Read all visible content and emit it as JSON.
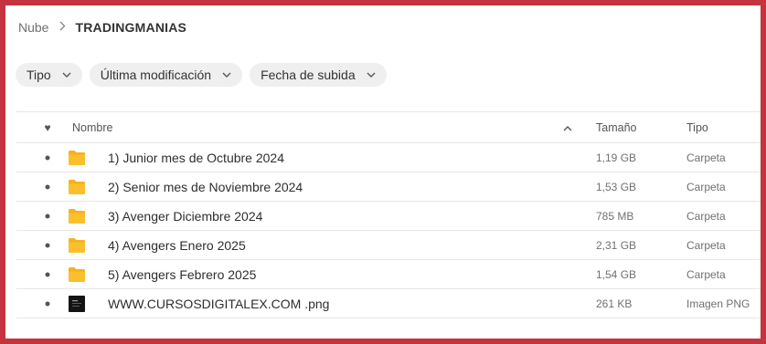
{
  "breadcrumb": {
    "root": "Nube",
    "current": "TRADINGMANIAS"
  },
  "filters": [
    {
      "label": "Tipo"
    },
    {
      "label": "Última modificación"
    },
    {
      "label": "Fecha de subida"
    }
  ],
  "table": {
    "headers": {
      "name": "Nombre",
      "size": "Tamaño",
      "type": "Tipo"
    },
    "rows": [
      {
        "name": "1) Junior mes de Octubre 2024",
        "size": "1,19 GB",
        "type": "Carpeta",
        "icon": "folder-icon"
      },
      {
        "name": "2) Senior mes de Noviembre 2024",
        "size": "1,53 GB",
        "type": "Carpeta",
        "icon": "folder-icon"
      },
      {
        "name": "3) Avenger Diciembre 2024",
        "size": "785 MB",
        "type": "Carpeta",
        "icon": "folder-icon"
      },
      {
        "name": "4) Avengers Enero 2025",
        "size": "2,31 GB",
        "type": "Carpeta",
        "icon": "folder-icon"
      },
      {
        "name": "5) Avengers Febrero 2025",
        "size": "1,54 GB",
        "type": "Carpeta",
        "icon": "folder-icon"
      },
      {
        "name": "WWW.CURSOSDIGITALEX.COM .png",
        "size": "261 KB",
        "type": "Imagen PNG",
        "icon": "image-thumbnail-icon"
      }
    ]
  },
  "colors": {
    "frame": "#c4343f",
    "folder": "#f6b21b",
    "chip_bg": "#efefef"
  }
}
